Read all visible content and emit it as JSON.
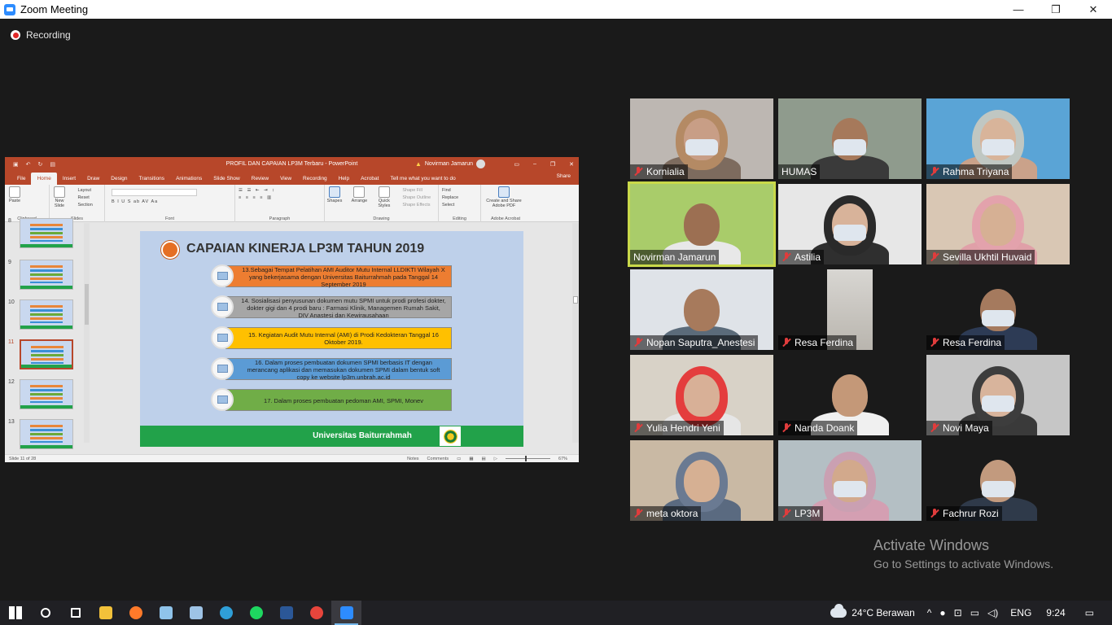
{
  "window": {
    "title": "Zoom Meeting",
    "minimize": "—",
    "restore": "❐",
    "close": "✕"
  },
  "recording": {
    "label": "Recording"
  },
  "ppt": {
    "doc_title": "PROFIL DAN CAPAIAN LP3M Terbaru - PowerPoint",
    "user": "Novirman Jamarun",
    "user_initials": "NJ",
    "tabs": [
      "File",
      "Home",
      "Insert",
      "Draw",
      "Design",
      "Transitions",
      "Animations",
      "Slide Show",
      "Review",
      "View",
      "Recording",
      "Help",
      "Acrobat"
    ],
    "tell_me": "Tell me what you want to do",
    "share": "Share",
    "ribbon": {
      "clipboard": {
        "name": "Clipboard",
        "paste": "Paste"
      },
      "slides": {
        "name": "Slides",
        "new_slide": "New Slide",
        "layout": "Layout",
        "reset": "Reset",
        "section": "Section"
      },
      "font": {
        "name": "Font",
        "buttons": "B  I  U  S  ab  AV  Aa"
      },
      "paragraph": {
        "name": "Paragraph"
      },
      "drawing": {
        "name": "Drawing",
        "shapes": "Shapes",
        "arrange": "Arrange",
        "quick_styles": "Quick Styles",
        "fill": "Shape Fill",
        "outline": "Shape Outline",
        "effects": "Shape Effects"
      },
      "editing": {
        "name": "Editing",
        "find": "Find",
        "replace": "Replace",
        "select": "Select"
      },
      "adobe": {
        "name": "Adobe Acrobat",
        "create": "Create and Share Adobe PDF"
      }
    },
    "thumbnails": [
      {
        "num": "8",
        "selected": false
      },
      {
        "num": "9",
        "selected": false
      },
      {
        "num": "10",
        "selected": false
      },
      {
        "num": "11",
        "selected": true
      },
      {
        "num": "12",
        "selected": false
      },
      {
        "num": "13",
        "selected": false
      }
    ],
    "slide": {
      "title": "CAPAIAN KINERJA LP3M TAHUN 2019",
      "items": [
        {
          "text": "13.Sebagai Tempat Pelatihan AMI Auditor Mutu Internal LLDIKTI Wilayah X yang bekerjasama dengan Universitas Baiturrahmah pada Tanggal 14 September 2019",
          "color": "#ed7d31"
        },
        {
          "text": "14. Sosialisasi penyusunan dokumen mutu SPMI untuk prodi profesi dokter, dokter gigi dan 4 prodi baru : Farmasi Klinik, Managemen Rumah Sakit, DIV Anastesi dan Kewirausahaan",
          "color": "#a6a6a6"
        },
        {
          "text": "15. Kegiatan Audit Mutu Internal (AMI) di Prodi Kedokteran Tanggal 16 Oktober 2019.",
          "color": "#ffc000"
        },
        {
          "text": "16. Dalam proses pembuatan dokumen SPMI berbasis IT dengan merancang aplikasi dan memasukan dokumen SPMI dalam bentuk soft copy ke website lp3m.unbrah.ac.id",
          "color": "#5b9bd5"
        },
        {
          "text": "17. Dalam proses pembuatan pedoman AMI, SPMI, Monev",
          "color": "#70ad47"
        }
      ],
      "footer": "Universitas Baiturrahmah"
    },
    "status": {
      "slide_of": "Slide 11 of 28",
      "notes": "Notes",
      "comments": "Comments",
      "zoom": "67%"
    }
  },
  "participants": [
    {
      "name": "Kornialia",
      "muted": true,
      "active": false,
      "bg": "#bdb7b2",
      "skin": "#c89e86",
      "cloth": "#7d6b5e",
      "mask": true,
      "hijab": "#b48a64"
    },
    {
      "name": "HUMAS",
      "muted": false,
      "active": false,
      "bg": "#8f9b8d",
      "skin": "#a6795b",
      "cloth": "#3a3a3a",
      "mask": true,
      "hijab": ""
    },
    {
      "name": "Rahma Triyana",
      "muted": true,
      "active": false,
      "bg": "#5aa4d6",
      "skin": "#d8b49a",
      "cloth": "#caa28a",
      "mask": true,
      "hijab": "#c0c7c2"
    },
    {
      "name": "Novirman Jamarun",
      "muted": false,
      "active": true,
      "bg": "#a9cc6a",
      "skin": "#9c6f52",
      "cloth": "#e8e8e8",
      "mask": false,
      "hijab": ""
    },
    {
      "name": "Astilia",
      "muted": true,
      "active": false,
      "bg": "#e7e7e7",
      "skin": "#d8b39a",
      "cloth": "#2f2f2f",
      "mask": true,
      "hijab": "#2a2a2a"
    },
    {
      "name": "Sevilla Ukhtil Huvaid",
      "muted": true,
      "active": false,
      "bg": "#d9c7b4",
      "skin": "#d6b094",
      "cloth": "#e0a0a8",
      "mask": false,
      "hijab": "#e3a2ac"
    },
    {
      "name": "Nopan Saputra_Anestesi",
      "muted": true,
      "active": false,
      "bg": "#dfe3e8",
      "skin": "#a77a5c",
      "cloth": "#5b6b7a",
      "mask": false,
      "hijab": ""
    },
    {
      "name": "Resa Ferdina",
      "muted": true,
      "active": false,
      "bg": "#1a1a1a",
      "skin": "",
      "cloth": "",
      "mask": false,
      "hijab": ""
    },
    {
      "name": "Resa Ferdina",
      "muted": true,
      "active": false,
      "bg": "#1a1a1a",
      "skin": "#a57a5e",
      "cloth": "#2d3b55",
      "mask": true,
      "hijab": ""
    },
    {
      "name": "Yulia Hendri Yeni",
      "muted": true,
      "active": false,
      "bg": "#d8d2c7",
      "skin": "#d8b097",
      "cloth": "#e6e6e6",
      "mask": false,
      "hijab": "#e43d3d"
    },
    {
      "name": "Nanda Doank",
      "muted": true,
      "active": false,
      "bg": "#1a1a1a",
      "skin": "#c49878",
      "cloth": "#f0f0f0",
      "mask": false,
      "hijab": ""
    },
    {
      "name": "Novi Maya",
      "muted": true,
      "active": false,
      "bg": "#c6c6c6",
      "skin": "#d8b49c",
      "cloth": "#3a3a3a",
      "mask": true,
      "hijab": "#3d3d3d"
    },
    {
      "name": "meta oktora",
      "muted": true,
      "active": false,
      "bg": "#c9b9a4",
      "skin": "#d6b093",
      "cloth": "#5a6a80",
      "mask": false,
      "hijab": "#6a7a92"
    },
    {
      "name": "LP3M",
      "muted": true,
      "active": false,
      "bg": "#b4bfc4",
      "skin": "#d2a98c",
      "cloth": "#d49fb2",
      "mask": true,
      "hijab": "#caa0b2"
    },
    {
      "name": "Fachrur Rozi",
      "muted": true,
      "active": false,
      "bg": "#1a1a1a",
      "skin": "#c29a7e",
      "cloth": "#2f3a4a",
      "mask": true,
      "hijab": ""
    }
  ],
  "activate": {
    "line1": "Activate Windows",
    "line2": "Go to Settings to activate Windows."
  },
  "taskbar": {
    "apps": [
      {
        "name": "start-icon",
        "color": "#ffffff"
      },
      {
        "name": "search-icon",
        "color": "#ffffff"
      },
      {
        "name": "task-view-icon",
        "color": "#ffffff"
      },
      {
        "name": "file-explorer-icon",
        "color": "#f2c13a"
      },
      {
        "name": "firefox-icon",
        "color": "#ff7a2a"
      },
      {
        "name": "paint-icon",
        "color": "#8fc3ea"
      },
      {
        "name": "notepad-icon",
        "color": "#9ec3e6"
      },
      {
        "name": "edge-icon",
        "color": "#2f9fd8"
      },
      {
        "name": "spotify-icon",
        "color": "#1ed760"
      },
      {
        "name": "word-icon",
        "color": "#2b5797"
      },
      {
        "name": "chrome-icon",
        "color": "#e8453c"
      },
      {
        "name": "zoom-icon",
        "color": "#2d8cff"
      }
    ],
    "weather": "24°C  Berawan",
    "lang": "ENG",
    "time": "9:24"
  }
}
